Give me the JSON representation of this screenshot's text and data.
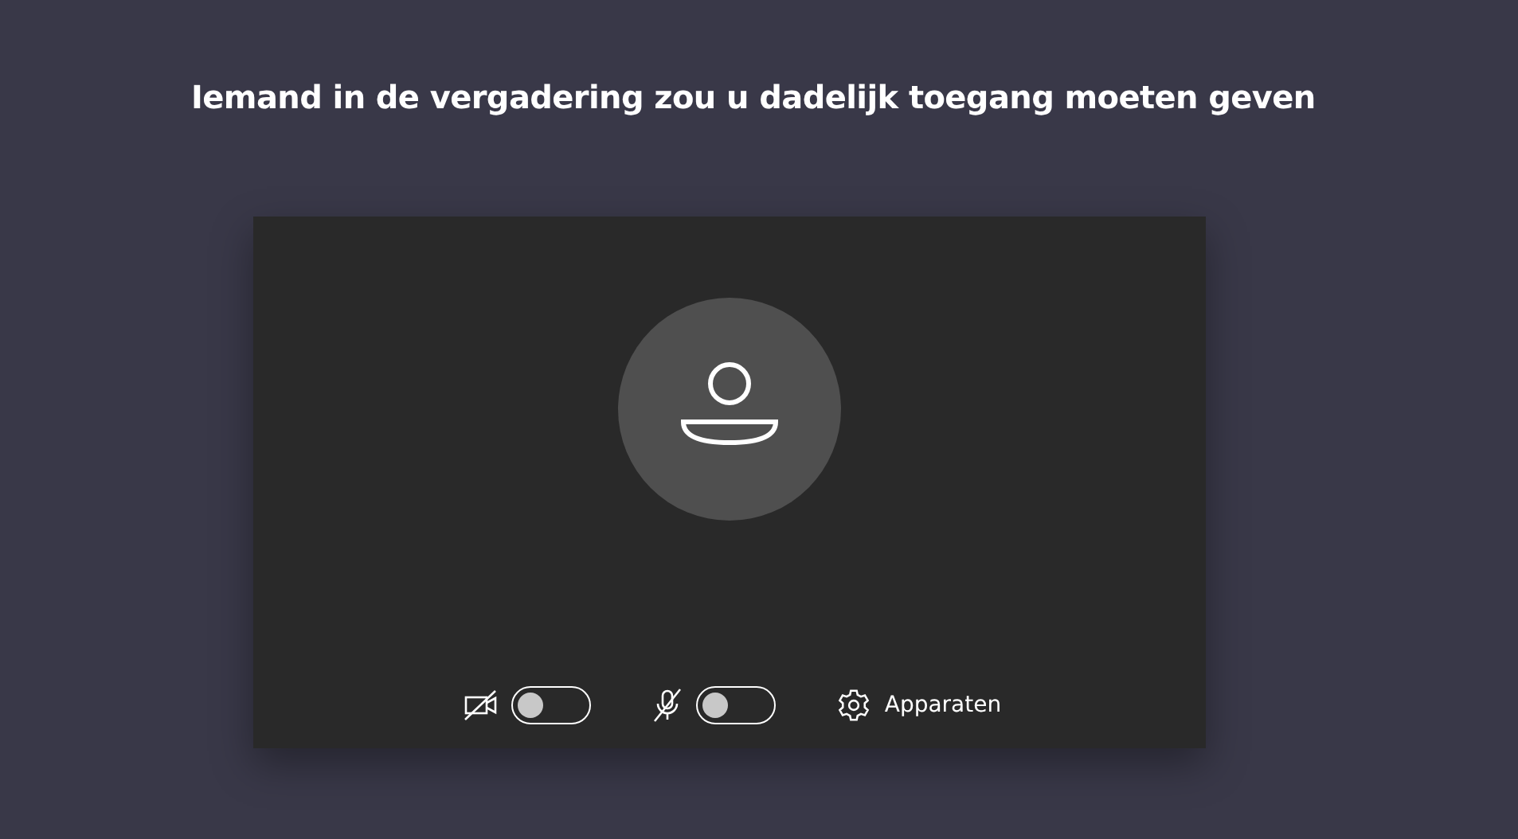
{
  "heading": "Iemand in de vergadering zou u dadelijk toegang moeten geven",
  "controls": [
    {
      "kind": "camera",
      "on": false
    },
    {
      "kind": "microphone",
      "on": false
    }
  ],
  "devices_button": {
    "label": "Apparaten"
  }
}
